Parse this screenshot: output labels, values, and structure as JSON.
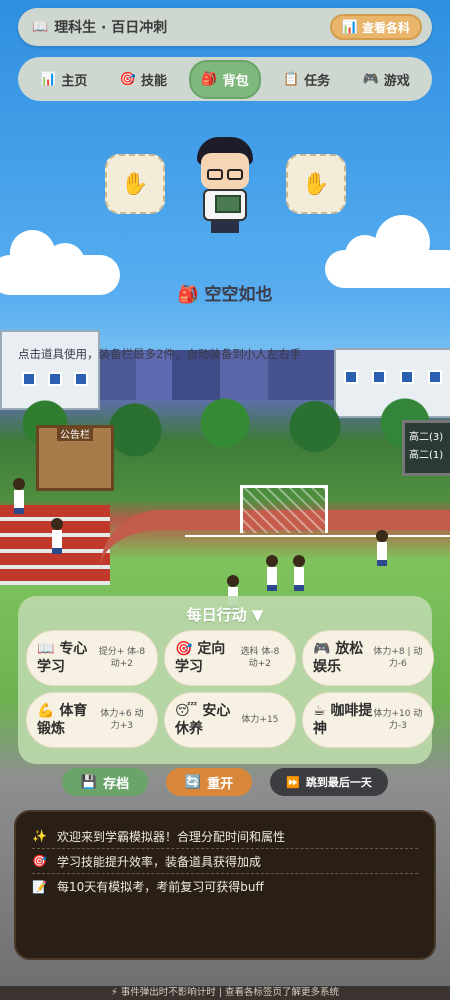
{
  "header": {
    "title": "理科生 · 百日冲刺",
    "title_icon": "book-icon",
    "subjects_button": "查看各科",
    "subjects_icon": "chart-icon"
  },
  "nav": {
    "items": [
      {
        "label": "主页",
        "icon": "chart-icon"
      },
      {
        "label": "技能",
        "icon": "target-icon"
      },
      {
        "label": "背包",
        "icon": "backpack-icon"
      },
      {
        "label": "任务",
        "icon": "clipboard-icon"
      },
      {
        "label": "游戏",
        "icon": "gamepad-icon"
      }
    ],
    "active": "背包"
  },
  "inventory": {
    "empty_text": "空空如也",
    "hint": "点击道具使用，装备栏最多2件，自动装备到小人左右手"
  },
  "scene": {
    "board_label": "公告栏",
    "scoreboard_lines": [
      "高二(3)",
      "高二(1)"
    ]
  },
  "actions": {
    "title": "每日行动 ▼",
    "items": [
      {
        "icon": "📖",
        "name": "专心学习",
        "effect": "提分+ 体-8 动+2"
      },
      {
        "icon": "🎯",
        "name": "定向学习",
        "effect": "选科 体-8 动+2"
      },
      {
        "icon": "🎮",
        "name": "放松娱乐",
        "effect": "体力+8 | 动力-6"
      },
      {
        "icon": "💪",
        "name": "体育锻炼",
        "effect": "体力+6 动力+3"
      },
      {
        "icon": "😴",
        "name": "安心休养",
        "effect": "体力+15"
      },
      {
        "icon": "☕",
        "name": "咖啡提神",
        "effect": "体力+10 动力-3"
      }
    ]
  },
  "buttons": {
    "save": "存档",
    "restart": "重开",
    "skip": "跳到最后一天"
  },
  "log": [
    {
      "icon": "✨",
      "text": "欢迎来到学霸模拟器！合理分配时间和属性"
    },
    {
      "icon": "🎯",
      "text": "学习技能提升效率，装备道具获得加成"
    },
    {
      "icon": "📝",
      "text": "每10天有模拟考，考前复习可获得buff"
    }
  ],
  "footer": "⚡ 事件弹出时不影响计时 | 查看各标签页了解更多系统",
  "colors": {
    "active_tab": "#7fb87c",
    "subjects_button": "#e8b56b",
    "save": "#6aa46a",
    "restart": "#d9873a",
    "skip": "#3b3d40",
    "log_bg": "#2a1f17"
  }
}
